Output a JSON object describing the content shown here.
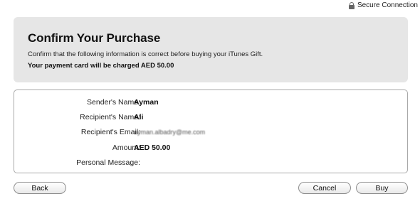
{
  "header": {
    "secure_label": "Secure Connection",
    "icon": "lock-icon"
  },
  "banner": {
    "title": "Confirm Your Purchase",
    "intro": "Confirm that the following information is correct before buying your iTunes Gift.",
    "charge": "Your payment card will be charged AED 50.00"
  },
  "details": {
    "sender_label": "Sender's Name:",
    "sender_value": "Ayman",
    "recipient_label": "Recipient's Name:",
    "recipient_value": "Ali",
    "email_label": "Recipient's Email:",
    "email_value": "ayman.albadry@me.com",
    "amount_label": "Amount:",
    "amount_value": "AED 50.00",
    "message_label": "Personal Message:",
    "message_value": ""
  },
  "buttons": {
    "back": "Back",
    "cancel": "Cancel",
    "buy": "Buy"
  }
}
